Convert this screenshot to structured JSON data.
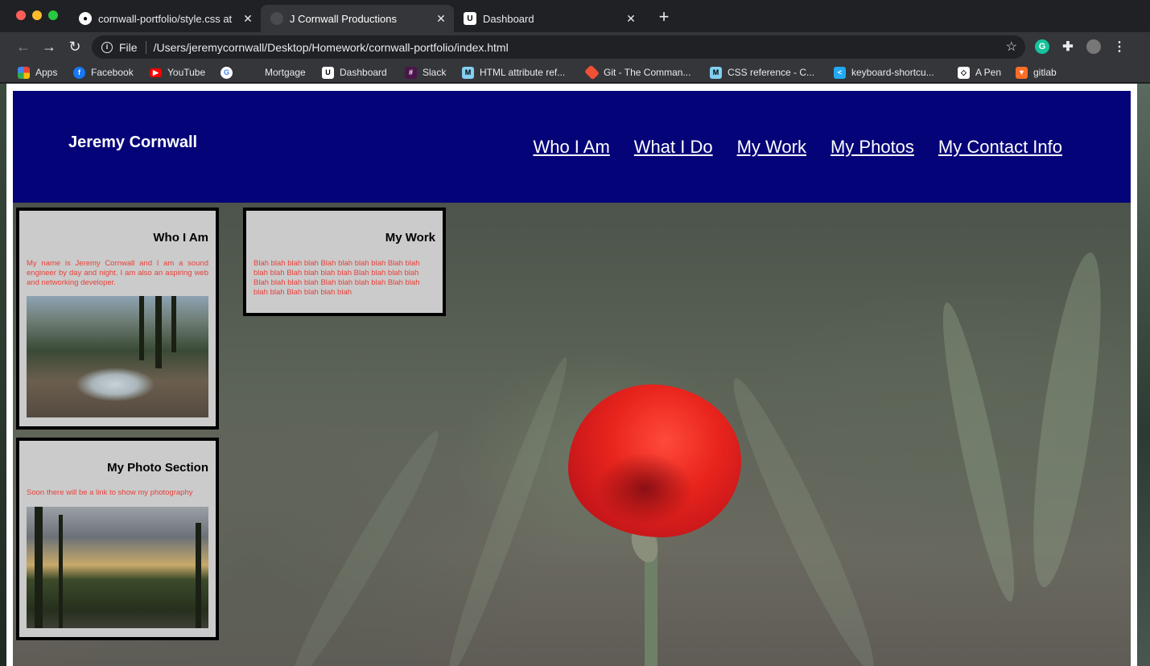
{
  "browser": {
    "tabs": [
      {
        "title": "cornwall-portfolio/style.css at",
        "icon": "github-icon",
        "active": false
      },
      {
        "title": "J Cornwall Productions",
        "icon": "globe-icon",
        "active": true
      },
      {
        "title": "Dashboard",
        "icon": "utah-u-icon",
        "active": false
      }
    ],
    "address": {
      "scheme_label": "File",
      "url": "/Users/jeremycornwall/Desktop/Homework/cornwall-portfolio/index.html"
    },
    "bookmarks": [
      {
        "label": "Apps",
        "icon": "apps-grid-icon",
        "color": "#ea4335"
      },
      {
        "label": "Facebook",
        "icon": "facebook-icon",
        "color": "#1877f2"
      },
      {
        "label": "YouTube",
        "icon": "youtube-icon",
        "color": "#ff0000"
      },
      {
        "label": "",
        "icon": "google-icon",
        "color": "#ffffff"
      },
      {
        "label": "Mortgage",
        "icon": "",
        "color": ""
      },
      {
        "label": "Dashboard",
        "icon": "utah-u-icon",
        "color": "#ffffff"
      },
      {
        "label": "Slack",
        "icon": "slack-icon",
        "color": "#4a154b"
      },
      {
        "label": "HTML attribute ref...",
        "icon": "mdn-icon",
        "color": "#83d0f2"
      },
      {
        "label": "Git - The Comman...",
        "icon": "git-icon",
        "color": "#f05033"
      },
      {
        "label": "CSS reference - C...",
        "icon": "mdn-icon",
        "color": "#83d0f2"
      },
      {
        "label": "keyboard-shortcu...",
        "icon": "vscode-icon",
        "color": "#23a9f2"
      },
      {
        "label": "A Pen",
        "icon": "codepen-icon",
        "color": "#ffffff"
      },
      {
        "label": "gitlab",
        "icon": "gitlab-icon",
        "color": "#fc6d26"
      }
    ]
  },
  "page": {
    "brand": "Jeremy Cornwall",
    "nav": [
      "Who I Am",
      "What I Do",
      "My Work",
      "My Photos",
      "My Contact Info"
    ],
    "header_color": "#050378",
    "cards": {
      "who": {
        "title": "Who I Am",
        "text": "My name is Jeremy Cornwall and I am a sound engineer by day and night. I am also an aspiring web and networking developer."
      },
      "work": {
        "title": "My Work",
        "text": "Blah blah blah blah Blah blah blah blah Blah blah blah blah Blah blah blah blah Blah blah blah blah Blah blah blah blah Blah blah blah blah Blah blah blah blah Blah blah blah blah"
      },
      "photo": {
        "title": "My Photo Section",
        "text": "Soon there will be a link to show my photography"
      }
    },
    "text_color": "#e8413a"
  }
}
